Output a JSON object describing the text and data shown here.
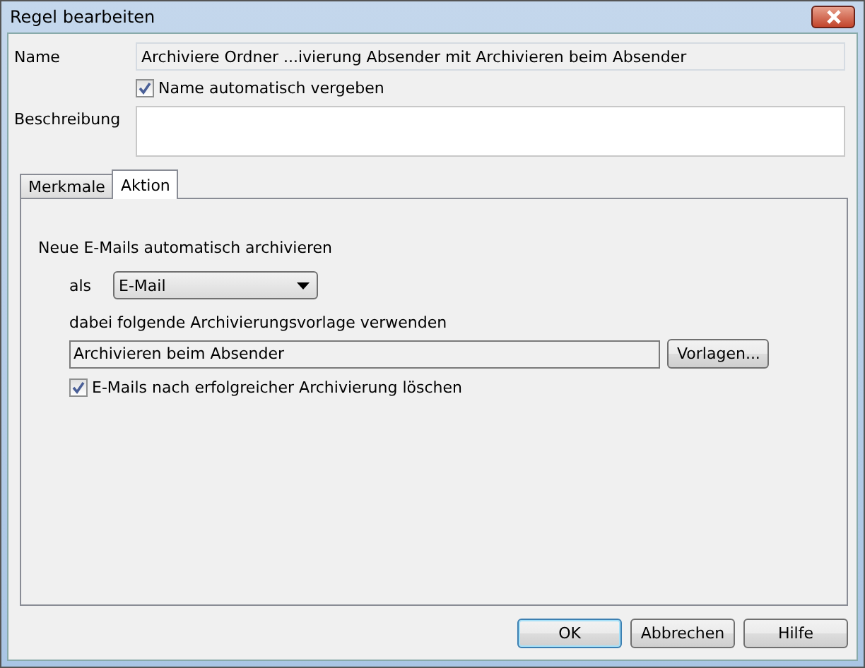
{
  "window": {
    "title": "Regel bearbeiten"
  },
  "name": {
    "label": "Name",
    "value": "Archiviere Ordner ...ivierung Absender mit Archivieren beim Absender",
    "disabled": true
  },
  "auto_name": {
    "label": "Name automatisch vergeben",
    "checked": true
  },
  "description": {
    "label": "Beschreibung"
  },
  "tabs": [
    {
      "label": "Merkmale",
      "selected": false
    },
    {
      "label": "Aktion",
      "selected": true
    }
  ],
  "action": {
    "heading": "Neue E-Mails automatisch archivieren",
    "as_label": "als",
    "as_value": "E-Mail",
    "template_label": "dabei folgende Archivierungsvorlage verwenden",
    "template_value": "Archivieren beim Absender",
    "templates_button": "Vorlagen...",
    "delete": {
      "label": "E-Mails nach erfolgreicher Archivierung löschen",
      "checked": true
    }
  },
  "buttons": [
    {
      "label": "OK",
      "default": true
    },
    {
      "label": "Abbrechen",
      "default": false
    },
    {
      "label": "Hilfe",
      "default": false
    }
  ]
}
